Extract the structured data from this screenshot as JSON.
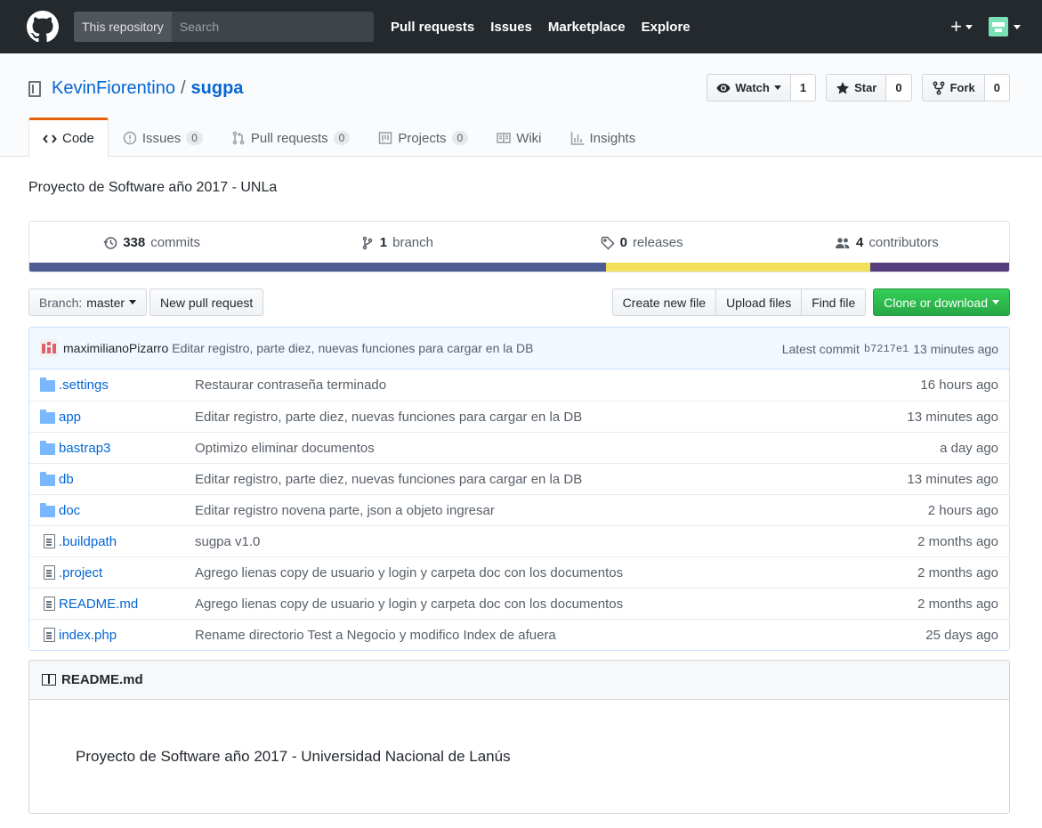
{
  "header": {
    "search_scope": "This repository",
    "search_placeholder": "Search",
    "nav": [
      "Pull requests",
      "Issues",
      "Marketplace",
      "Explore"
    ],
    "plus": "+"
  },
  "repo": {
    "owner": "KevinFiorentino",
    "separator": "/",
    "name": "sugpa",
    "watch_label": "Watch",
    "watch_count": "1",
    "star_label": "Star",
    "star_count": "0",
    "fork_label": "Fork",
    "fork_count": "0"
  },
  "tabs": [
    {
      "label": "Code",
      "icon": "code-icon"
    },
    {
      "label": "Issues",
      "count": "0",
      "icon": "issue-icon"
    },
    {
      "label": "Pull requests",
      "count": "0",
      "icon": "pull-request-icon"
    },
    {
      "label": "Projects",
      "count": "0",
      "icon": "project-icon"
    },
    {
      "label": "Wiki",
      "icon": "book-icon"
    },
    {
      "label": "Insights",
      "icon": "graph-icon"
    }
  ],
  "description": "Proyecto de Software año 2017 - UNLa",
  "summary": {
    "commits_count": "338",
    "commits_label": "commits",
    "branch_count": "1",
    "branch_label": "branch",
    "releases_count": "0",
    "releases_label": "releases",
    "contributors_count": "4",
    "contributors_label": "contributors"
  },
  "languages": [
    {
      "fraction": 0.589,
      "color": "#4F5D95"
    },
    {
      "fraction": 0.269,
      "color": "#f1e05a"
    },
    {
      "fraction": 0.142,
      "color": "#563d7c"
    }
  ],
  "file_nav": {
    "branch_label": "Branch:",
    "branch_value": "master",
    "new_pr": "New pull request",
    "create_file": "Create new file",
    "upload_files": "Upload files",
    "find_file": "Find file",
    "clone": "Clone or download"
  },
  "latest_commit": {
    "author": "maximilianoPizarro",
    "message": "Editar registro, parte diez, nuevas funciones para cargar en la DB",
    "label": "Latest commit",
    "sha": "b7217e1",
    "age": "13 minutes ago"
  },
  "files": [
    {
      "type": "dir",
      "name": ".settings",
      "message": "Restaurar contraseña terminado",
      "age": "16 hours ago"
    },
    {
      "type": "dir",
      "name": "app",
      "message": "Editar registro, parte diez, nuevas funciones para cargar en la DB",
      "age": "13 minutes ago"
    },
    {
      "type": "dir",
      "name": "bastrap3",
      "message": "Optimizo eliminar documentos",
      "age": "a day ago"
    },
    {
      "type": "dir",
      "name": "db",
      "message": "Editar registro, parte diez, nuevas funciones para cargar en la DB",
      "age": "13 minutes ago"
    },
    {
      "type": "dir",
      "name": "doc",
      "message": "Editar registro novena parte, json a objeto ingresar",
      "age": "2 hours ago"
    },
    {
      "type": "file",
      "name": ".buildpath",
      "message": "sugpa v1.0",
      "age": "2 months ago"
    },
    {
      "type": "file",
      "name": ".project",
      "message": "Agrego lienas copy de usuario y login y carpeta doc con los documentos",
      "age": "2 months ago"
    },
    {
      "type": "file",
      "name": "README.md",
      "message": "Agrego lienas copy de usuario y login y carpeta doc con los documentos",
      "age": "2 months ago"
    },
    {
      "type": "file",
      "name": "index.php",
      "message": "Rename directorio Test a Negocio y modifico Index de afuera",
      "age": "25 days ago"
    }
  ],
  "readme": {
    "title": "README.md",
    "body": "Proyecto de Software año 2017 - Universidad Nacional de Lanús"
  }
}
